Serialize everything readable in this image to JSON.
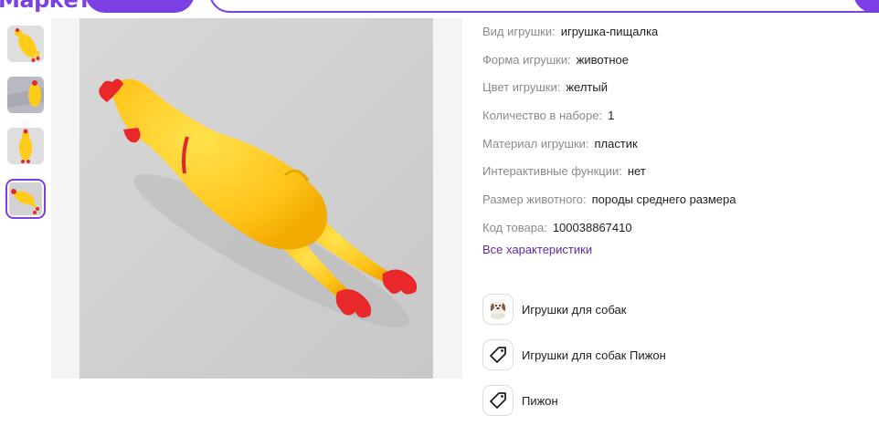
{
  "header": {
    "logo": "Маркет",
    "catalog_button": "",
    "search_placeholder": ""
  },
  "gallery": {
    "thumbnails": [
      "chicken-toy-thumb-1",
      "chicken-toy-thumb-2",
      "chicken-toy-thumb-3",
      "chicken-toy-thumb-4"
    ],
    "active_index": 3
  },
  "specs": [
    {
      "label": "Вид игрушки:",
      "value": "игрушка-пищалка"
    },
    {
      "label": "Форма игрушки:",
      "value": "животное"
    },
    {
      "label": "Цвет игрушки:",
      "value": "желтый"
    },
    {
      "label": "Количество в наборе:",
      "value": "1"
    },
    {
      "label": "Материал игрушки:",
      "value": "пластик"
    },
    {
      "label": "Интерактивные функции:",
      "value": "нет"
    },
    {
      "label": "Размер животного:",
      "value": "породы среднего размера"
    },
    {
      "label": "Код товара:",
      "value": "100038867410"
    }
  ],
  "all_specs_link": "Все характеристики",
  "categories": [
    {
      "label": "Игрушки для собак",
      "icon": "dog-icon"
    },
    {
      "label": "Игрушки для собак Пижон",
      "icon": "tag-icon"
    },
    {
      "label": "Пижон",
      "icon": "tag-icon"
    }
  ],
  "colors": {
    "accent": "#7b3fe4",
    "link": "#5e2ca5",
    "toy_yellow": "#ffcf1a",
    "toy_red": "#e8282b"
  }
}
